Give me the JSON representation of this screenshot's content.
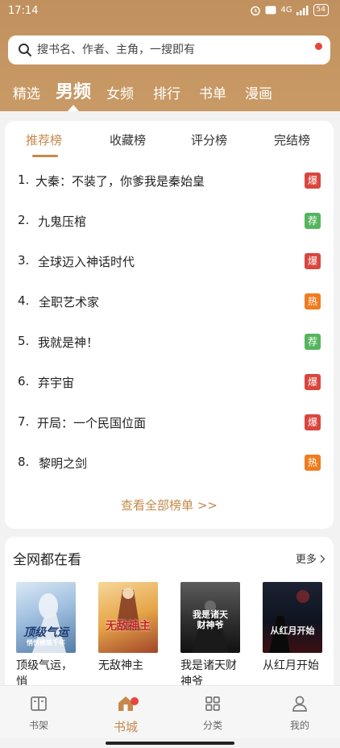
{
  "status_bar": {
    "time": "17:14",
    "network": "4G",
    "battery": "54"
  },
  "search": {
    "placeholder": "搜书名、作者、主角，一搜即有"
  },
  "category_tabs": [
    {
      "label": "精选",
      "active": false
    },
    {
      "label": "男频",
      "active": true
    },
    {
      "label": "女频",
      "active": false
    },
    {
      "label": "排行",
      "active": false
    },
    {
      "label": "书单",
      "active": false
    },
    {
      "label": "漫画",
      "active": false
    }
  ],
  "ranking": {
    "tabs": [
      {
        "label": "推荐榜",
        "active": true
      },
      {
        "label": "收藏榜",
        "active": false
      },
      {
        "label": "评分榜",
        "active": false
      },
      {
        "label": "完结榜",
        "active": false
      }
    ],
    "items": [
      {
        "rank": "1.",
        "title": "大秦：不装了，你爹我是秦始皇",
        "badge": "爆",
        "badge_color": "#d9463e"
      },
      {
        "rank": "2.",
        "title": "九鬼压棺",
        "badge": "荐",
        "badge_color": "#55b55c"
      },
      {
        "rank": "3.",
        "title": "全球迈入神话时代",
        "badge": "爆",
        "badge_color": "#d9463e"
      },
      {
        "rank": "4.",
        "title": "全职艺术家",
        "badge": "热",
        "badge_color": "#f07c20"
      },
      {
        "rank": "5.",
        "title": "我就是神！",
        "badge": "荐",
        "badge_color": "#55b55c"
      },
      {
        "rank": "6.",
        "title": "弃宇宙",
        "badge": "爆",
        "badge_color": "#d9463e"
      },
      {
        "rank": "7.",
        "title": "开局：一个民国位面",
        "badge": "爆",
        "badge_color": "#d9463e"
      },
      {
        "rank": "8.",
        "title": "黎明之剑",
        "badge": "热",
        "badge_color": "#f07c20"
      }
    ],
    "view_all": "查看全部榜单 >>"
  },
  "trending": {
    "title": "全网都在看",
    "more": "更多",
    "books": [
      {
        "title": "顶级气运，悄",
        "cover_text": "顶级气运",
        "cover_sub": "悄悄修炼千年"
      },
      {
        "title": "无敌神主",
        "cover_text": "无敌神主",
        "cover_sub": ""
      },
      {
        "title": "我是诸天财神爷",
        "cover_text": "我是诸天财神爷",
        "cover_sub": ""
      },
      {
        "title": "从红月开始",
        "cover_text": "从红月开始",
        "cover_sub": ""
      }
    ]
  },
  "bottom_nav": [
    {
      "label": "书架",
      "icon": "bookshelf-icon",
      "active": false
    },
    {
      "label": "书城",
      "icon": "bookstore-icon",
      "active": true
    },
    {
      "label": "分类",
      "icon": "category-grid-icon",
      "active": false
    },
    {
      "label": "我的",
      "icon": "profile-icon",
      "active": false
    }
  ],
  "colors": {
    "accent": "#c4894a",
    "header": "#c99a66",
    "badge_red": "#d9463e",
    "badge_green": "#55b55c",
    "badge_orange": "#f07c20"
  }
}
